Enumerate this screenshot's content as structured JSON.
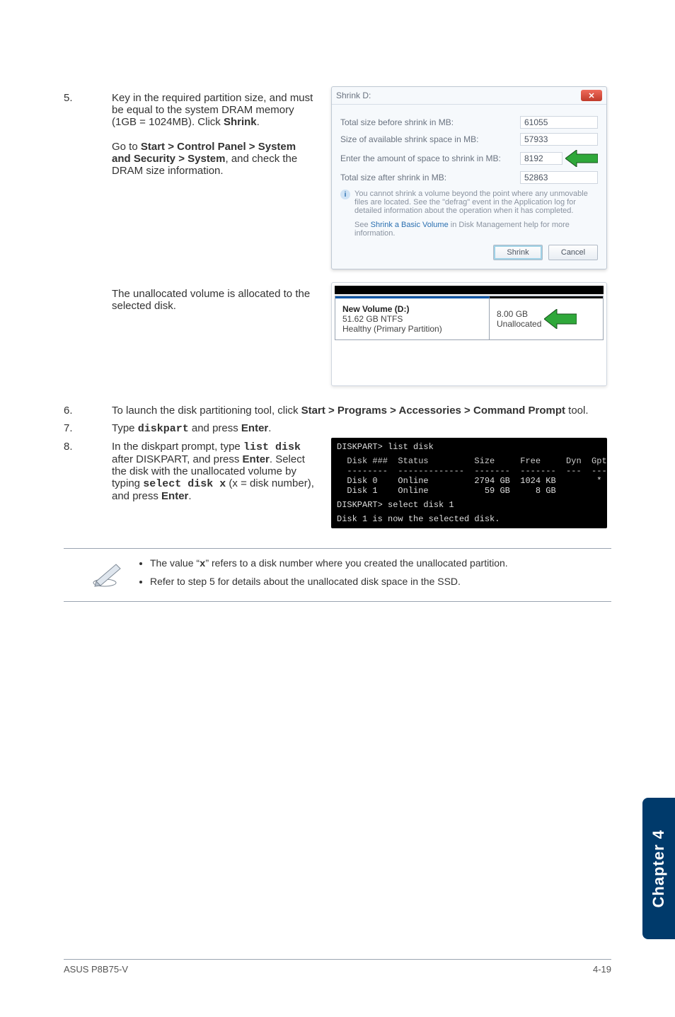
{
  "sidetab": {
    "label": "Chapter 4"
  },
  "footer": {
    "left": "ASUS P8B75-V",
    "right": "4-19"
  },
  "step5": {
    "num": "5.",
    "text_a": "Key in the required partition size, and must be equal to the system DRAM memory (1GB = 1024MB). Click ",
    "text_bold": "Shrink",
    "text_b": ".",
    "goto_prefix": "Go to ",
    "goto_bold": "Start > Control Panel > System and Security > System",
    "goto_suffix": ", and check the DRAM size information.",
    "unalloc": "The unallocated volume is allocated to the selected disk."
  },
  "shrink_dialog": {
    "title": "Shrink D:",
    "row1": "Total size before shrink in MB:",
    "row1_val": "61055",
    "row2": "Size of available shrink space in MB:",
    "row2_val": "57933",
    "row3": "Enter the amount of space to shrink in MB:",
    "row3_val": "8192",
    "row4": "Total size after shrink in MB:",
    "row4_val": "52863",
    "note": "You cannot shrink a volume beyond the point where any unmovable files are located. See the \"defrag\" event in the Application log for detailed information about the operation when it has completed.",
    "see_prefix": "See ",
    "see_link": "Shrink a Basic Volume",
    "see_suffix": " in Disk Management help for more information.",
    "btn_primary": "Shrink",
    "btn_cancel": "Cancel"
  },
  "dm": {
    "vol_name": "New Volume (D:)",
    "vol_size": "51.62 GB NTFS",
    "vol_status": "Healthy (Primary Partition)",
    "unalloc_size": "8.00 GB",
    "unalloc_label": "Unallocated"
  },
  "step6": {
    "num": "6.",
    "text_a": "To launch the disk partitioning tool, click ",
    "text_bold": "Start > Programs > Accessories > Command Prompt",
    "text_b": " tool."
  },
  "step7": {
    "num": "7.",
    "text_a": "Type ",
    "cmd": "diskpart",
    "text_b": " and press ",
    "text_bold": "Enter",
    "text_c": "."
  },
  "step8": {
    "num": "8.",
    "text_a": "In the diskpart prompt, type ",
    "cmd1": "list disk",
    "text_b": " after DISKPART, and press ",
    "bold_enter1": "Enter",
    "text_c": ". Select the disk with the unallocated volume by typing ",
    "cmd2": "select disk x",
    "text_d": " (x = disk number), and press ",
    "bold_enter2": "Enter",
    "text_e": "."
  },
  "terminal": {
    "line1": "DISKPART> list disk",
    "hdr": "  Disk ###  Status         Size     Free     Dyn  Gpt",
    "sep": "  --------  -------------  -------  -------  ---  ---",
    "d0": "  Disk 0    Online         2794 GB  1024 KB        *",
    "d1": "  Disk 1    Online           59 GB     8 GB",
    "line2": "DISKPART> select disk 1",
    "line3": "Disk 1 is now the selected disk."
  },
  "notebox": {
    "item1_a": "The value “",
    "item1_cmd": "x",
    "item1_b": "” refers to a disk number where you created the unallocated partition.",
    "item2": "Refer to step 5 for details about the unallocated disk space in the SSD."
  }
}
